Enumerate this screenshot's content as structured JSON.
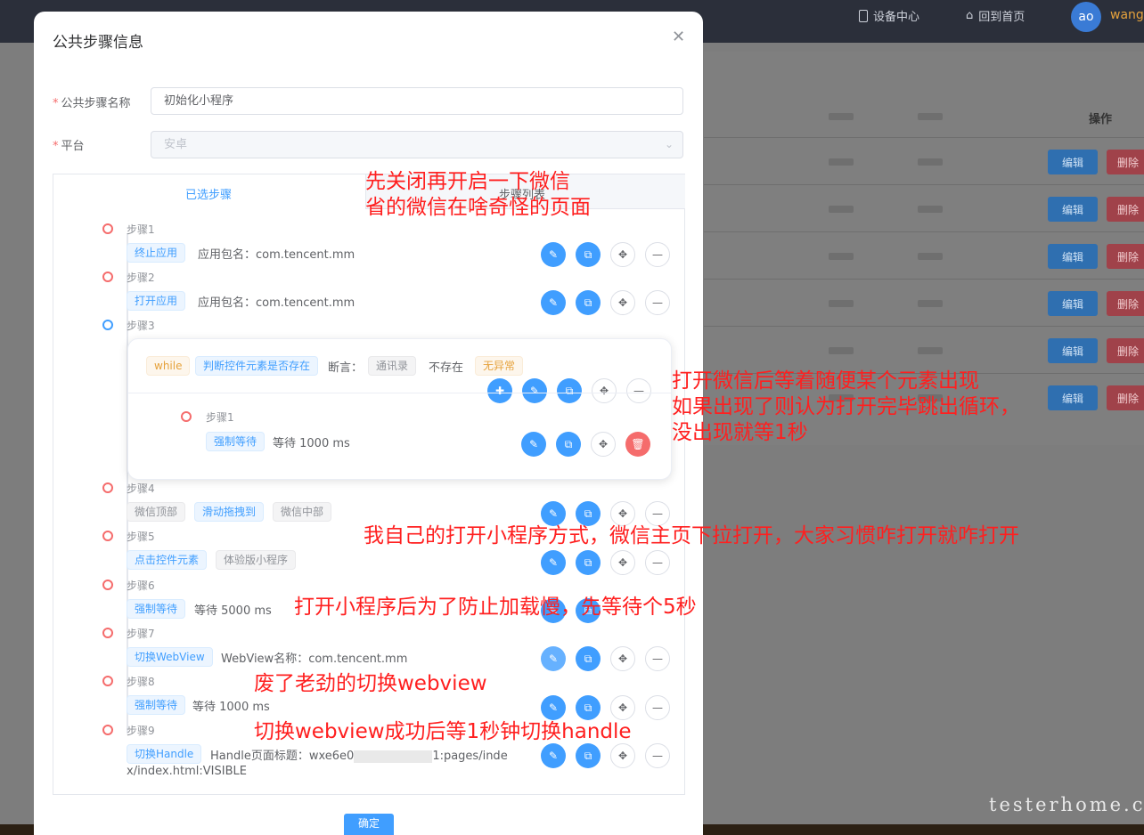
{
  "topbar": {
    "device_center": "设备中心",
    "home": "回到首页",
    "avatar_text": "ao",
    "username": "wang"
  },
  "background": {
    "operation_header": "操作",
    "edit": "编辑",
    "delete": "删除"
  },
  "dialog": {
    "title": "公共步骤信息",
    "name_label": "公共步骤名称",
    "name_value": "初始化小程序",
    "platform_label": "平台",
    "platform_value": "安卓",
    "tab_selected": "已选步骤",
    "tab_list": "步骤列表",
    "confirm": "确定"
  },
  "steps": {
    "s1": {
      "label": "步骤1",
      "tag": "终止应用",
      "text": "应用包名：com.tencent.mm"
    },
    "s2": {
      "label": "步骤2",
      "tag": "打开应用",
      "text": "应用包名：com.tencent.mm"
    },
    "s3": {
      "label": "步骤3",
      "tag_while": "while",
      "tag_judge": "判断控件元素是否存在",
      "assert_label": "断言：",
      "tag_contacts": "通讯录",
      "not_exist": "不存在",
      "tag_no_exception": "无异常",
      "child": {
        "label": "步骤1",
        "tag": "强制等待",
        "text": "等待 1000 ms"
      }
    },
    "s4": {
      "label": "步骤4",
      "tag_a": "微信顶部",
      "tag_b": "滑动拖拽到",
      "tag_c": "微信中部"
    },
    "s5": {
      "label": "步骤5",
      "tag_a": "点击控件元素",
      "tag_b": "体验版小程序"
    },
    "s6": {
      "label": "步骤6",
      "tag": "强制等待",
      "text": "等待 5000 ms"
    },
    "s7": {
      "label": "步骤7",
      "tag": "切换WebView",
      "text": "WebView名称：com.tencent.mm"
    },
    "s8": {
      "label": "步骤8",
      "tag": "强制等待",
      "text": "等待 1000 ms"
    },
    "s9": {
      "label": "步骤9",
      "tag": "切换Handle",
      "text_a": "Handle页面标题：wxe6e0",
      "text_b": "1:pages/inde",
      "text_c": "x/index.html:VISIBLE"
    }
  },
  "annotations": {
    "a1_line1": "先关闭再开启一下微信",
    "a1_line2": "省的微信在啥奇怪的页面",
    "a2_line1": "打开微信后等着随便某个元素出现",
    "a2_line2": "如果出现了则认为打开完毕跳出循环，",
    "a2_line3": "没出现就等1秒",
    "a3": "我自己的打开小程序方式，微信主页下拉打开，大家习惯咋打开就咋打开",
    "a4": "打开小程序后为了防止加载慢，先等待个5秒",
    "a5": "废了老劲的切换webview",
    "a6": "切换webview成功后等1秒钟切换handle"
  },
  "watermark": "testerhome.com"
}
